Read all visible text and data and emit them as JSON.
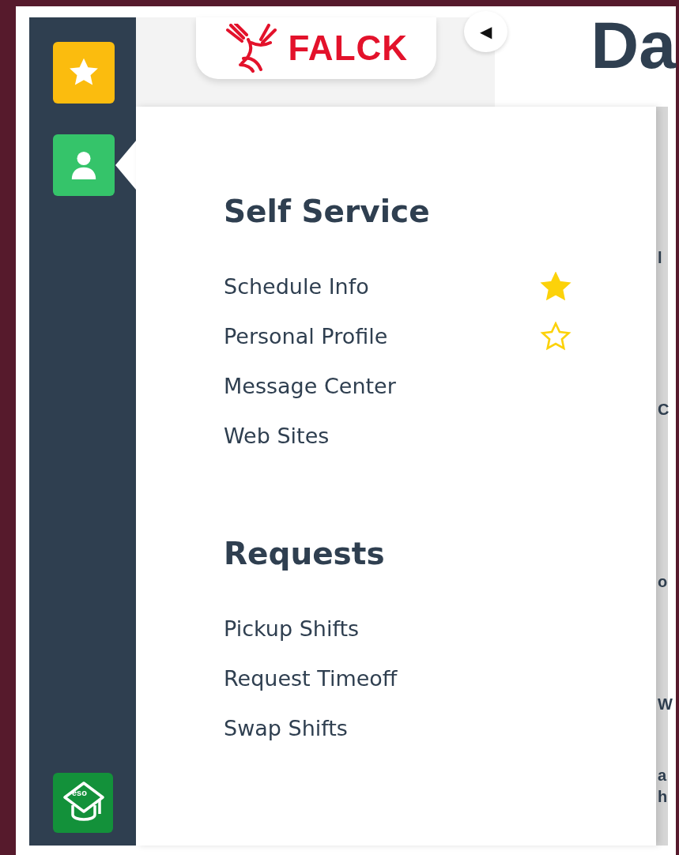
{
  "sidebar": {
    "items": [
      {
        "kind": "star",
        "color": "#fbbc0e",
        "selected": false
      },
      {
        "kind": "person",
        "color": "#35c46a",
        "selected": true
      }
    ],
    "footer": {
      "kind": "cap",
      "color": "#13913a",
      "label": "eso"
    }
  },
  "header": {
    "logo": {
      "text": "FALCK"
    },
    "collapse_button": {
      "glyph": "◀"
    },
    "page_title": "Da"
  },
  "background_fragments": [
    "l",
    "C",
    "o",
    "W",
    "a",
    "h"
  ],
  "menu": {
    "sections": [
      {
        "title": "Self Service",
        "items": [
          {
            "label": "Schedule Info",
            "favorite": true
          },
          {
            "label": "Personal Profile",
            "favorite": false
          },
          {
            "label": "Message Center"
          },
          {
            "label": "Web Sites"
          }
        ]
      },
      {
        "title": "Requests",
        "items": [
          {
            "label": "Pickup Shifts"
          },
          {
            "label": "Request Timeoff"
          },
          {
            "label": "Swap Shifts"
          }
        ]
      }
    ]
  }
}
